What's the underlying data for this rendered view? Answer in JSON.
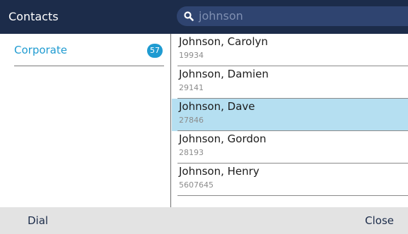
{
  "header": {
    "title": "Contacts",
    "search": {
      "value": "johnson"
    }
  },
  "groups": [
    {
      "label": "Corporate",
      "count": "57"
    }
  ],
  "contacts": [
    {
      "name": "Johnson, Carolyn",
      "number": "19934",
      "selected": false
    },
    {
      "name": "Johnson, Damien",
      "number": "29141",
      "selected": false
    },
    {
      "name": "Johnson, Dave",
      "number": "27846",
      "selected": true
    },
    {
      "name": "Johnson, Gordon",
      "number": "28193",
      "selected": false
    },
    {
      "name": "Johnson, Henry",
      "number": "5607645",
      "selected": false
    }
  ],
  "softkeys": {
    "left": "Dial",
    "right": "Close"
  },
  "colors": {
    "header_bg": "#1c2c4a",
    "search_bg": "#2f4470",
    "accent": "#1f9bd1",
    "selected_row": "#b5dff1",
    "footer_bg": "#e3e3e3"
  },
  "icons": {
    "search": "search-icon"
  }
}
